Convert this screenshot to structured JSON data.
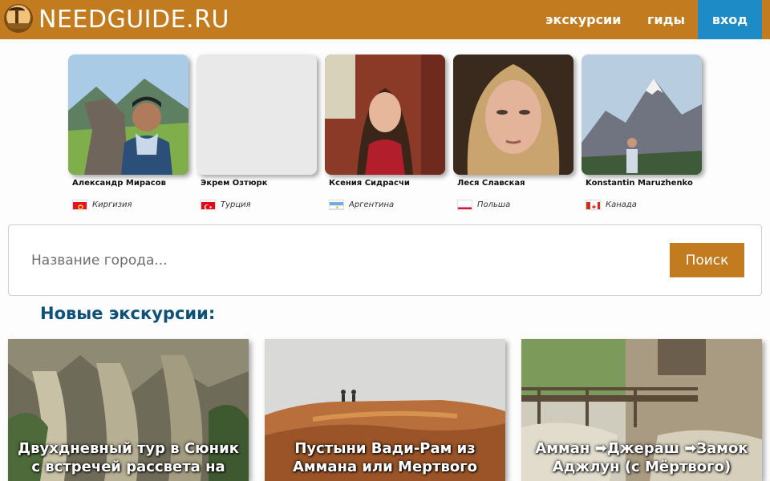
{
  "header": {
    "brand": "NEEDGUIDE.RU",
    "nav": {
      "tours": "экскурсии",
      "guides": "гиды",
      "login": "вход"
    }
  },
  "guides": [
    {
      "name": "Александр Мирасов",
      "country": "Киргизия",
      "flag_icon": "kyrgyzstan-flag"
    },
    {
      "name": "Экрем Озтюрк",
      "country": "Турция",
      "flag_icon": "turkey-flag"
    },
    {
      "name": "Ксения Сидрасчи",
      "country": "Аргентина",
      "flag_icon": "argentina-flag"
    },
    {
      "name": "Леся Славская",
      "country": "Польша",
      "flag_icon": "poland-flag"
    },
    {
      "name": "Konstantin Maruzhenko",
      "country": "Канада",
      "flag_icon": "canada-flag"
    }
  ],
  "search": {
    "placeholder": "Название города...",
    "value": "",
    "button": "Поиск"
  },
  "section": {
    "title": "Новые экскурсии:"
  },
  "tours": [
    {
      "title": "Двухдневный тур в Сюник с встречей рассвета на"
    },
    {
      "title": "Пустыни Вади-Рам из Аммана или Мертвого"
    },
    {
      "title": "Амман ➡Джераш ➡Замок Аджлун (с Мёртвого)"
    }
  ],
  "colors": {
    "brand": "#c27b1f",
    "login": "#1c8bc6",
    "title": "#0e5078"
  }
}
